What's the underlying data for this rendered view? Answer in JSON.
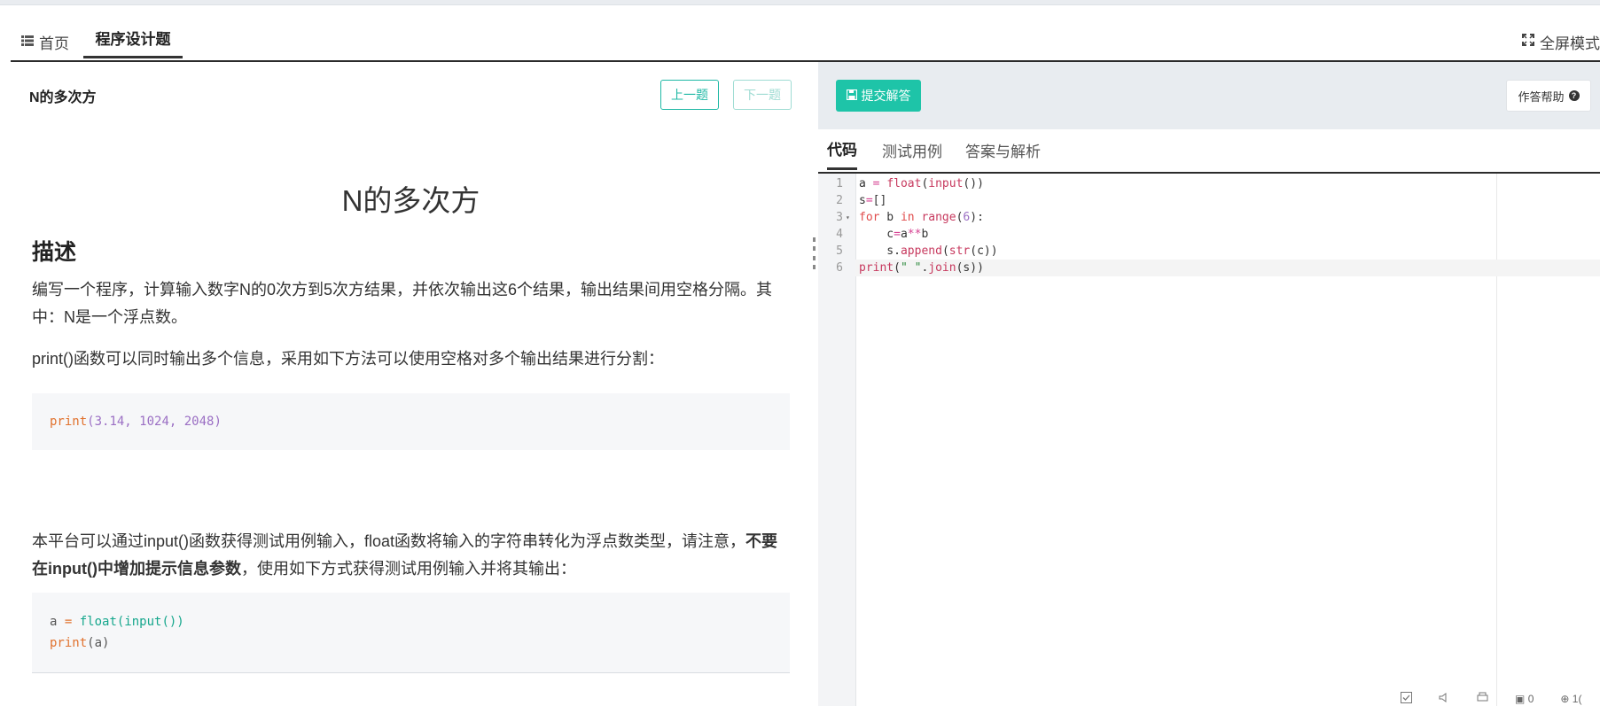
{
  "header": {
    "home_label": "首页",
    "active_tab": "程序设计题",
    "fullscreen_label": "全屏模式"
  },
  "problem": {
    "short_title": "N的多次方",
    "prev_label": "上一题",
    "next_label": "下一题",
    "title": "N的多次方",
    "section_heading": "描述",
    "para1": "编写一个程序，计算输入数字N的0次方到5次方结果，并依次输出这6个结果，输出结果间用空格分隔。其中：N是一个浮点数。",
    "para2": "print()函数可以同时输出多个信息，采用如下方法可以使用空格对多个输出结果进行分割：",
    "code1": {
      "fn": "print",
      "args": "(3.14, 1024, 2048)"
    },
    "para3_prefix": "本平台可以通过input()函数获得测试用例输入，float函数将输入的字符串转化为浮点数类型，请注意，",
    "para3_bold": "不要在input()中增加提示信息参数",
    "para3_suffix": "，使用如下方式获得测试用例输入并将其输出：",
    "code2": {
      "line1_var": "a",
      "line1_eq": " = ",
      "line1_fn": "float(input())",
      "line2_fn": "print",
      "line2_args": "(a)"
    }
  },
  "editor": {
    "submit_label": "提交解答",
    "help_label": "作答帮助",
    "tabs": [
      "代码",
      "测试用例",
      "答案与解析"
    ],
    "line_numbers": [
      "1",
      "2",
      "3",
      "4",
      "5",
      "6"
    ],
    "code_lines": [
      "a = float(input())",
      "s=[]",
      "for b in range(6):",
      "    c=a**b",
      "    s.append(str(c))",
      "print(\" \".join(s))"
    ]
  },
  "status": {
    "count_a": "0",
    "count_b": "1("
  },
  "colors": {
    "accent": "#1ec4a8",
    "outline_button": "#1fb8a5",
    "code_keyword": "#e1722e",
    "code_builtin": "#16a78d",
    "code_number": "#9b6fc4"
  }
}
